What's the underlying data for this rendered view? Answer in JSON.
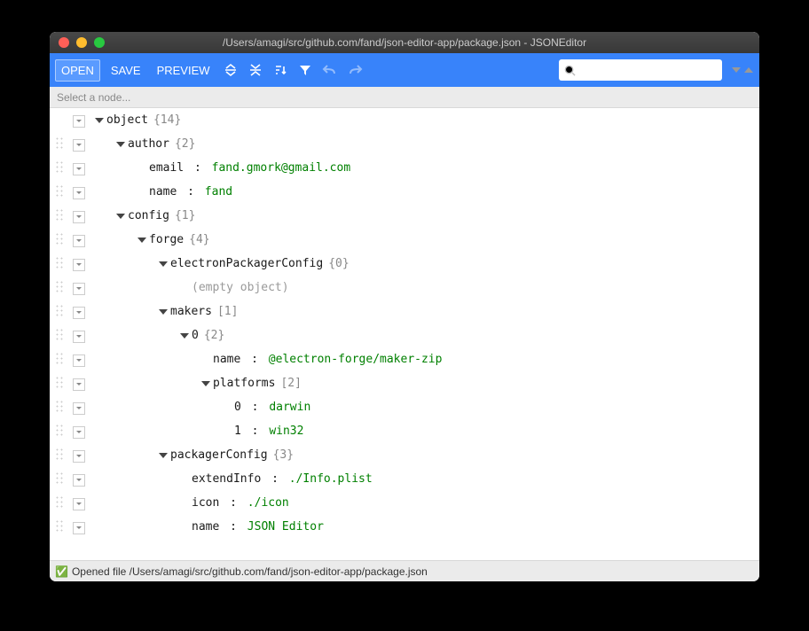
{
  "window": {
    "title": "/Users/amagi/src/github.com/fand/json-editor-app/package.json - JSONEditor"
  },
  "toolbar": {
    "open": "OPEN",
    "save": "SAVE",
    "preview": "PREVIEW"
  },
  "search": {
    "placeholder": ""
  },
  "breadcrumb": {
    "placeholder": "Select a node..."
  },
  "status": {
    "icon": "✅",
    "text": "Opened file /Users/amagi/src/github.com/fand/json-editor-app/package.json"
  },
  "tree": [
    {
      "depth": 0,
      "drag": false,
      "toggle": true,
      "key": "object",
      "count": "{14}"
    },
    {
      "depth": 1,
      "drag": true,
      "toggle": true,
      "key": "author",
      "count": "{2}"
    },
    {
      "depth": 2,
      "drag": true,
      "toggle": false,
      "key": "email",
      "sep": ":",
      "value": "fand.gmork@gmail.com",
      "vclass": "k-str"
    },
    {
      "depth": 2,
      "drag": true,
      "toggle": false,
      "key": "name",
      "sep": ":",
      "value": "fand",
      "vclass": "k-str"
    },
    {
      "depth": 1,
      "drag": true,
      "toggle": true,
      "key": "config",
      "count": "{1}"
    },
    {
      "depth": 2,
      "drag": true,
      "toggle": true,
      "key": "forge",
      "count": "{4}"
    },
    {
      "depth": 3,
      "drag": true,
      "toggle": true,
      "key": "electronPackagerConfig",
      "count": "{0}"
    },
    {
      "depth": 4,
      "drag": true,
      "toggle": false,
      "empty": "(empty object)"
    },
    {
      "depth": 3,
      "drag": true,
      "toggle": true,
      "key": "makers",
      "count": "[1]"
    },
    {
      "depth": 4,
      "drag": true,
      "toggle": true,
      "key": "0",
      "count": "{2}",
      "keyclass": "k-idx"
    },
    {
      "depth": 5,
      "drag": true,
      "toggle": false,
      "key": "name",
      "sep": ":",
      "value": "@electron-forge/maker-zip",
      "vclass": "k-str"
    },
    {
      "depth": 5,
      "drag": true,
      "toggle": true,
      "key": "platforms",
      "count": "[2]"
    },
    {
      "depth": 6,
      "drag": true,
      "toggle": false,
      "key": "0",
      "sep": ":",
      "value": "darwin",
      "vclass": "k-str",
      "keyclass": "k-idx"
    },
    {
      "depth": 6,
      "drag": true,
      "toggle": false,
      "key": "1",
      "sep": ":",
      "value": "win32",
      "vclass": "k-str",
      "keyclass": "k-idx"
    },
    {
      "depth": 3,
      "drag": true,
      "toggle": true,
      "key": "packagerConfig",
      "count": "{3}"
    },
    {
      "depth": 4,
      "drag": true,
      "toggle": false,
      "key": "extendInfo",
      "sep": ":",
      "value": "./Info.plist",
      "vclass": "k-str"
    },
    {
      "depth": 4,
      "drag": true,
      "toggle": false,
      "key": "icon",
      "sep": ":",
      "value": "./icon",
      "vclass": "k-str"
    },
    {
      "depth": 4,
      "drag": true,
      "toggle": false,
      "key": "name",
      "sep": ":",
      "value": "JSON Editor",
      "vclass": "k-str"
    }
  ]
}
